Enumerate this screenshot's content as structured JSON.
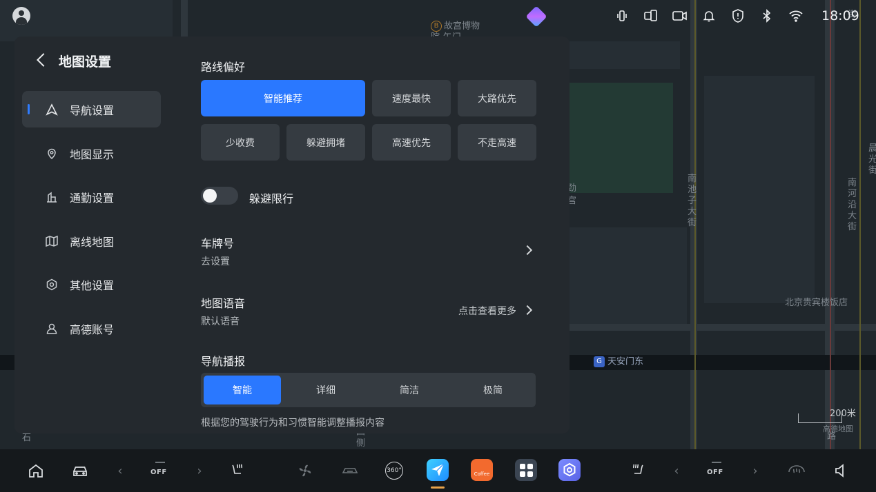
{
  "map": {
    "poi_palace": "故宫博物\n院-午门",
    "road_nanchizi": "南池子大街",
    "road_nanheyan": "南河沿大街",
    "hotel": "北京贵宾楼饭店",
    "metro_station": "天安门东",
    "metro_badge": "G",
    "scale": "200米",
    "brand": "高德地图",
    "frag_1": "劲",
    "frag_2": "宫",
    "frag_3": "四",
    "frag_4": "侧",
    "frag_5": "石",
    "frag_6": "路",
    "frag_7": "晨光街",
    "frag_8": "街"
  },
  "status": {
    "time": "18:09",
    "icons": [
      "phone-vibrate-icon",
      "screen-mirror-icon",
      "camera-icon",
      "bell-icon",
      "shield-icon",
      "bluetooth-icon",
      "wifi-icon"
    ]
  },
  "settings": {
    "title": "地图设置",
    "nav": [
      {
        "label": "导航设置",
        "icon": "navigation-arrow-icon",
        "active": true
      },
      {
        "label": "地图显示",
        "icon": "map-pin-icon",
        "active": false
      },
      {
        "label": "通勤设置",
        "icon": "commute-building-icon",
        "active": false
      },
      {
        "label": "离线地图",
        "icon": "offline-map-icon",
        "active": false
      },
      {
        "label": "其他设置",
        "icon": "gear-icon",
        "active": false
      },
      {
        "label": "高德账号",
        "icon": "user-icon",
        "active": false
      }
    ],
    "route_pref": {
      "title": "路线偏好",
      "options": [
        "智能推荐",
        "速度最快",
        "大路优先",
        "少收费",
        "躲避拥堵",
        "高速优先",
        "不走高速"
      ],
      "selected": "智能推荐"
    },
    "avoid_restriction": {
      "label": "躲避限行",
      "enabled": false
    },
    "plate": {
      "title": "车牌号",
      "sub": "去设置"
    },
    "voice": {
      "title": "地图语音",
      "sub": "默认语音",
      "more": "点击查看更多"
    },
    "broadcast": {
      "title": "导航播报",
      "options": [
        "智能",
        "详细",
        "简洁",
        "极简"
      ],
      "selected": "智能",
      "hint": "根据您的驾驶行为和习惯智能调整播报内容"
    }
  },
  "dock": {
    "fan_left_value": "--",
    "fan_left_state": "OFF",
    "fan_right_value": "--",
    "fan_right_state": "OFF",
    "app_360": "360°",
    "app_coffee": "Coffee"
  },
  "colors": {
    "accent": "#2a78ff",
    "panel": "#24292e",
    "chip": "#353b41"
  }
}
